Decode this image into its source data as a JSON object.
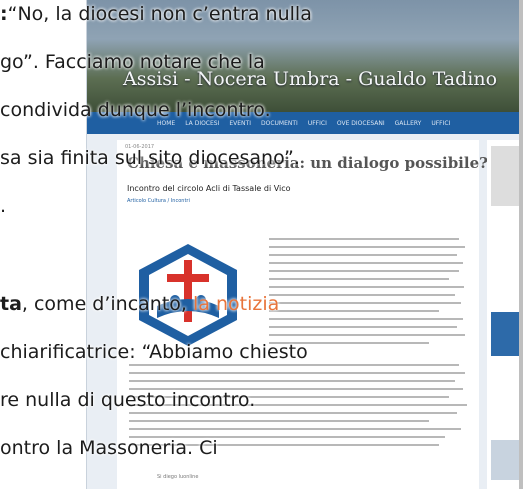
{
  "article_lines": [
    {
      "prefix": ":",
      "text": "“No, la diocesi non c’entra nulla"
    },
    {
      "text": "go”. Facciamo notare che la"
    },
    {
      "text": "condivida dunque l’incontro."
    },
    {
      "text": "sa sia finita sul sito diocesano”."
    },
    {
      "text": "."
    },
    {
      "bold": "ta",
      "text": ", come d’incanto, ",
      "link": "la notizia"
    },
    {
      "text": "chiarificatrice: “Abbiamo chiesto"
    },
    {
      "text": "re nulla di questo incontro."
    },
    {
      "text": "ontro la Massoneria. Ci"
    }
  ],
  "screenshot": {
    "site_title": "Assisi - Nocera Umbra - Gualdo Tadino",
    "nav_items": [
      "HOME",
      "LA DIOCESI",
      "EVENTI",
      "DOCUMENTI",
      "UFFICI",
      "OVE DIOCESANI",
      "GALLERY",
      "UFFICI"
    ],
    "breadcrumb": "01-06-2017",
    "article_title": "Chiesa e massoneria: un dialogo possibile?”",
    "article_subtitle": "Incontro del circolo Acli di Tassale di Vico",
    "article_meta": "Articolo Cultura / Incontri",
    "footer_snippet": "Si diego luonline"
  }
}
